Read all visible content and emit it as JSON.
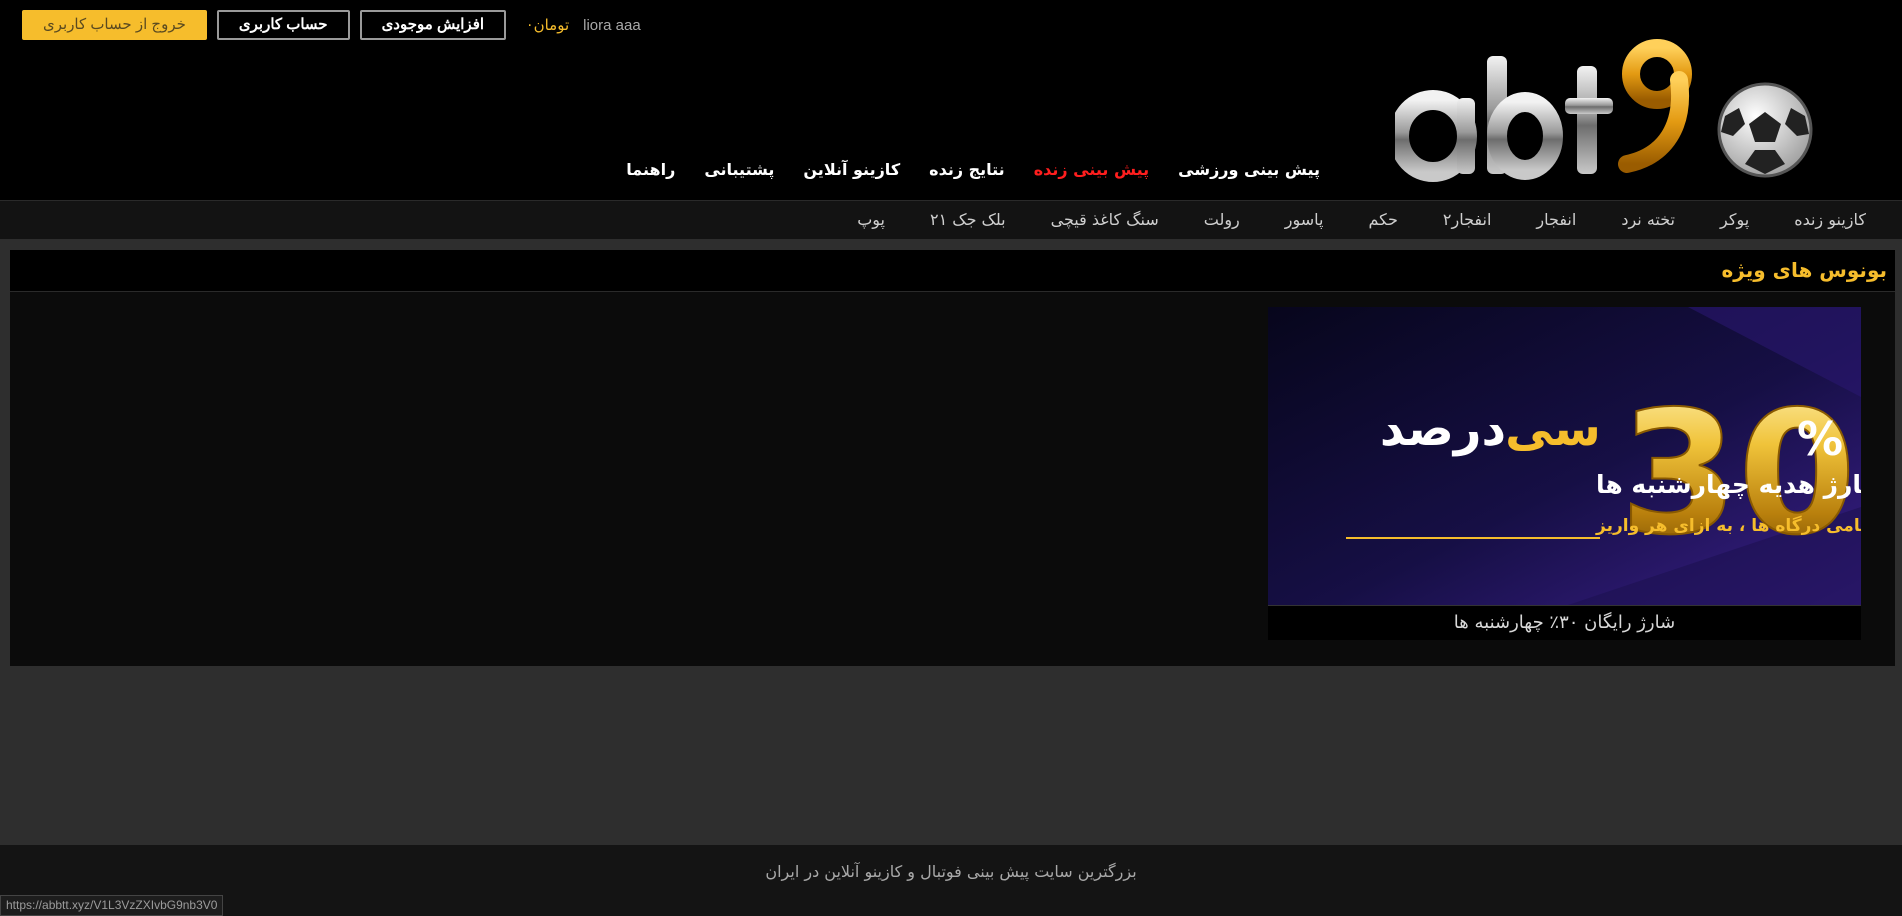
{
  "header": {
    "logout_label": "خروج از حساب کاربری",
    "account_label": "حساب کاربری",
    "deposit_label": "افزایش موجودی",
    "balance_amount": "۰",
    "balance_currency": "تومان",
    "username": "liora aaa",
    "logo_icon": "abt90-logo-icon"
  },
  "main_nav": {
    "items": [
      {
        "label": "پیش بینی ورزشی"
      },
      {
        "label": "پیش بینی زنده"
      },
      {
        "label": "نتایج زنده"
      },
      {
        "label": "کازینو آنلاین"
      },
      {
        "label": "پشتیبانی"
      },
      {
        "label": "راهنما"
      }
    ]
  },
  "sub_nav": {
    "items": [
      {
        "label": "کازینو زنده"
      },
      {
        "label": "پوکر"
      },
      {
        "label": "تخته نرد"
      },
      {
        "label": "انفجار"
      },
      {
        "label": "انفجار۲"
      },
      {
        "label": "حکم"
      },
      {
        "label": "پاسور"
      },
      {
        "label": "رولت"
      },
      {
        "label": "سنگ کاغذ قیچی"
      },
      {
        "label": "بلک جک ۲۱"
      },
      {
        "label": "پوپ"
      }
    ]
  },
  "bonus": {
    "title": "بونوس های ویژه",
    "banner": {
      "headline_white": "درصد",
      "headline_yellow": "سی",
      "subline": "شارژ هدیه چهارشنبه ها",
      "highlight": "از تمامی درگاه ها ، به ازای هر واریز",
      "big_number": "30",
      "percent_sign": "%"
    },
    "caption": "شارژ رایگان ۳۰٪ چهارشنبه ها"
  },
  "footer": {
    "text": "بزرگترین سایت پیش بینی فوتبال و کازینو آنلاین در ایران"
  },
  "status_bar": {
    "url": "https://abbtt.xyz/V1L3VzZXIvbG9nb3V0"
  },
  "colors": {
    "accent": "#f6bd2c",
    "active_nav": "#ff1e1e",
    "background": "#2e2e2e",
    "header_bg": "#000000"
  }
}
